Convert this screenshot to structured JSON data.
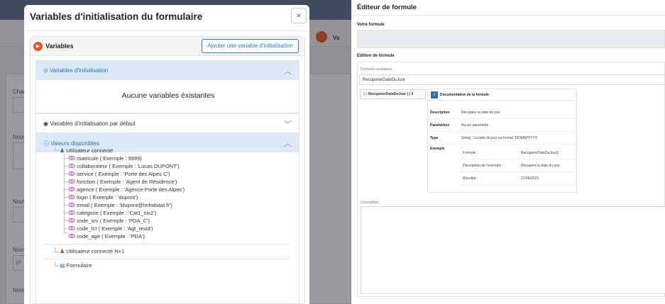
{
  "background": {
    "labels": [
      "Char",
      "Nouv",
      "Nouv",
      "Nouv",
      "Nouv"
    ],
    "date_placeholder": "jj/r",
    "partial_text": "Va"
  },
  "modal": {
    "title": "Variables d'initialisation du formulaire",
    "close_icon": "×",
    "section_title": "Variables",
    "add_button": "Ajouter une variable d'initialisation",
    "accordions": {
      "init_vars": {
        "label": "Variables d'initialisation",
        "expanded": true,
        "empty_message": "Aucune variables éxistantes"
      },
      "default_vars": {
        "label": "Variables d'initialisation par défaut",
        "expanded": false
      },
      "available_values": {
        "label": "Valeurs disponibles",
        "expanded": true
      }
    },
    "tree": {
      "connected_user": {
        "label": "Utilisateur connecté",
        "children": [
          "matricule ( Exemple : 9999)",
          "collaborateur ( Exemple : 'Lucas DUPONT')",
          "service ( Exemple : 'Porte des Alpes C')",
          "fonction ( Exemple : 'Agent de Résidence')",
          "agence ( Exemple : 'Agence Porte des Alpes')",
          "login ( Exemple : 'dupont')",
          "email ( Exemple : 'ldupont@lmhabitat.fr')",
          "categorie ( Exemple : 'Cat1_niv2')",
          "code_srv ( Exemple : 'PDA_C')",
          "code_fct ( Exemple : 'Agt_resid')",
          "code_age ( Exemple : 'PDA')"
        ]
      },
      "connected_user_n1": "Utilisateur connecté N+1",
      "form": "Formulaire"
    }
  },
  "editor": {
    "title": "Éditeur de formule",
    "votre_formule_label": "Votre formule",
    "edition_label": "Edition de formule",
    "formules_existantes_label": "Formules existantes",
    "selected_formula": "RecupererDateDuJour",
    "function_button": "RecupererDateDuJour ( )",
    "doc_title": "Documentation de la formule",
    "doc": {
      "description_key": "Description",
      "description_val": "Récupère la date du jour",
      "parametres_key": "Paramètres",
      "parametres_val": "Aucun paramètre",
      "type_key": "Type",
      "type_val": "String : La date du jour au format 'DD/MM/YYYY'",
      "exemple_key": "Exemple",
      "exemple_rows": [
        {
          "k": "Formule :",
          "v": "RecupererDateDuJour()"
        },
        {
          "k": "Description de l'exemple :",
          "v": "Récupère la date du jour"
        },
        {
          "k": "Résultat :",
          "v": "21/06/2023"
        }
      ]
    },
    "conception_label": "Conception"
  },
  "colors": {
    "accent_orange": "#e8551f",
    "accent_blue": "#2a7bd3",
    "accordion_active_bg": "#dceaf8",
    "variable_icon": "#b04eb8"
  }
}
